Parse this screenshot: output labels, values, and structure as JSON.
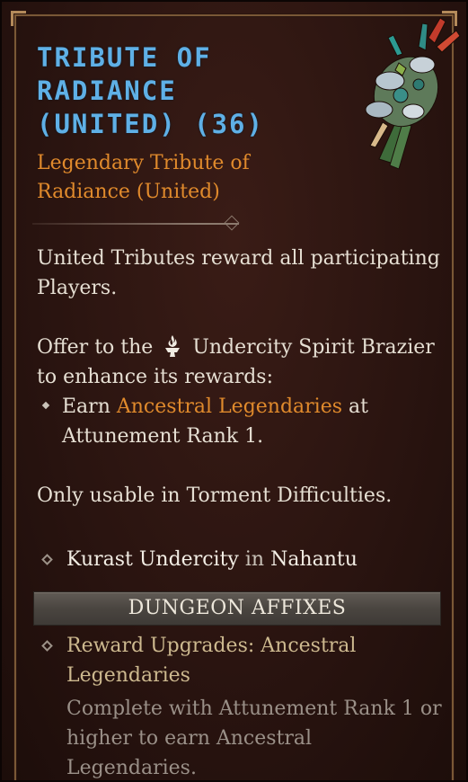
{
  "item": {
    "title_lines": [
      "Tribute of",
      "Radiance",
      "(United) (36)"
    ],
    "subtitle_lines": [
      "Legendary Tribute of",
      "Radiance (United)"
    ],
    "icon": "tribute-bouquet-icon"
  },
  "description": {
    "p1": "United Tributes reward all participating Players.",
    "offer_prefix": "Offer to the",
    "offer_target": "Undercity Spirit Brazier",
    "offer_suffix": "to enhance its rewards:",
    "brazier_icon": "spirit-brazier-icon",
    "bullet_prefix": "Earn",
    "bullet_highlight": "Ancestral Legendaries",
    "bullet_suffix": "at Attunement Rank 1.",
    "usable": "Only usable in Torment Difficulties."
  },
  "location": {
    "place": "Kurast Undercity",
    "connector": "in",
    "region": "Nahantu"
  },
  "affixes": {
    "header": "DUNGEON AFFIXES",
    "name": "Reward Upgrades: Ancestral Legendaries",
    "description": "Complete with Attunement Rank 1 or higher to earn Ancestral Legendaries."
  },
  "colors": {
    "title": "#5fb0e6",
    "legendary": "#e08a2c",
    "body": "#e6dfd3",
    "affix": "#cdb98f",
    "muted": "#9a9088"
  }
}
